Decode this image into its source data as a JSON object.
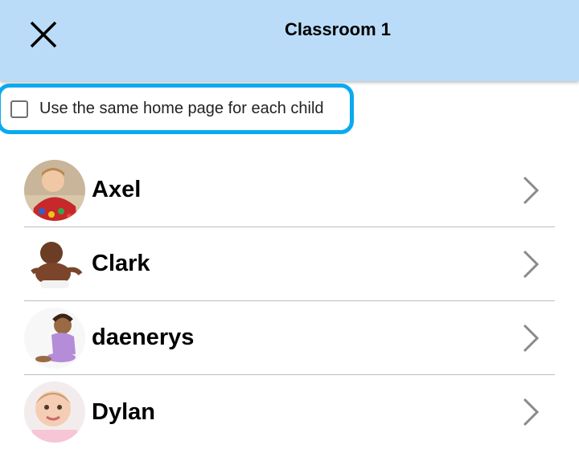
{
  "header": {
    "title": "Classroom 1",
    "close_icon": "close-icon",
    "background": "#badcf8"
  },
  "options": {
    "same_home_label": "Use the same home page for each child",
    "same_home_checked": false,
    "highlight_color": "#0aaaf0"
  },
  "children": [
    {
      "name": "Axel",
      "icon": "chevron-right-icon"
    },
    {
      "name": "Clark",
      "icon": "chevron-right-icon"
    },
    {
      "name": "daenerys",
      "icon": "chevron-right-icon"
    },
    {
      "name": "Dylan",
      "icon": "chevron-right-icon"
    }
  ]
}
